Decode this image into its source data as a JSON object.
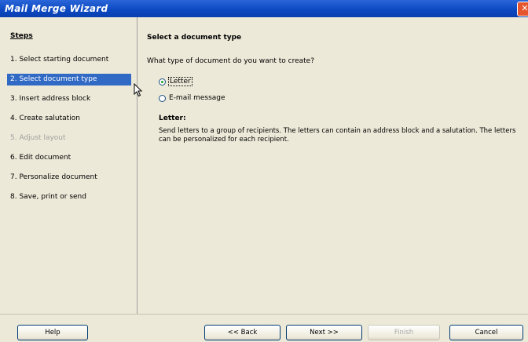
{
  "window": {
    "title": "Mail Merge Wizard",
    "close_symbol": "✕"
  },
  "sidebar": {
    "heading": "Steps",
    "steps": [
      {
        "label": "1.  Select starting document",
        "state": "normal"
      },
      {
        "label": "2.  Select document type",
        "state": "active"
      },
      {
        "label": "3.  Insert address block",
        "state": "normal"
      },
      {
        "label": "4.  Create salutation",
        "state": "normal"
      },
      {
        "label": "5.  Adjust layout",
        "state": "disabled"
      },
      {
        "label": "6.  Edit document",
        "state": "normal"
      },
      {
        "label": "7.  Personalize document",
        "state": "normal"
      },
      {
        "label": "8.  Save, print or send",
        "state": "normal"
      }
    ]
  },
  "main": {
    "title": "Select a document type",
    "question": "What type of document do you want to create?",
    "options": [
      {
        "label": "Letter",
        "selected": true
      },
      {
        "label": "E-mail message",
        "selected": false
      }
    ],
    "description_title": "Letter:",
    "description": "Send letters to a group of recipients. The letters can contain an address block and a salutation. The letters can be personalized for each recipient."
  },
  "buttons": {
    "help": "Help",
    "back": "<< Back",
    "next": "Next >>",
    "finish": "Finish",
    "cancel": "Cancel"
  }
}
